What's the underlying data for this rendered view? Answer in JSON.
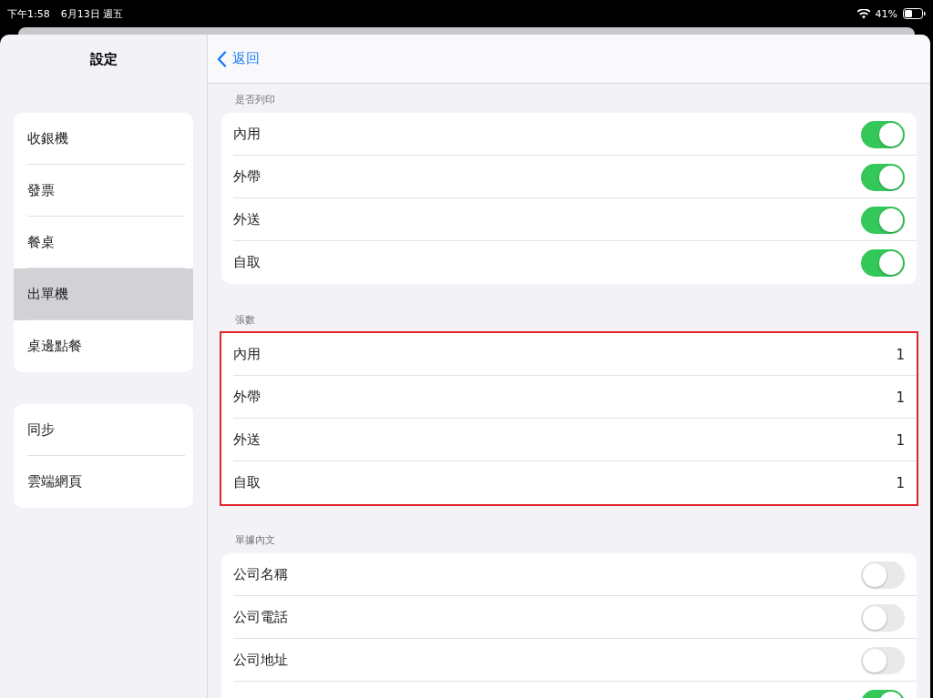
{
  "status_bar": {
    "time": "下午1:58",
    "date": "6月13日 週五",
    "battery": "41%"
  },
  "sidebar": {
    "title": "設定",
    "groups": [
      {
        "items": [
          {
            "label": "收銀機",
            "selected": false
          },
          {
            "label": "發票",
            "selected": false
          },
          {
            "label": "餐桌",
            "selected": false
          },
          {
            "label": "出單機",
            "selected": true
          },
          {
            "label": "桌邊點餐",
            "selected": false
          }
        ]
      },
      {
        "items": [
          {
            "label": "同步",
            "selected": false
          },
          {
            "label": "雲端網頁",
            "selected": false
          }
        ]
      }
    ]
  },
  "nav": {
    "back": "返回"
  },
  "sections": [
    {
      "header": "是否列印",
      "highlighted": false,
      "rows": [
        {
          "kind": "toggle",
          "label": "內用",
          "on": true
        },
        {
          "kind": "toggle",
          "label": "外帶",
          "on": true
        },
        {
          "kind": "toggle",
          "label": "外送",
          "on": true
        },
        {
          "kind": "toggle",
          "label": "自取",
          "on": true
        }
      ]
    },
    {
      "header": "張數",
      "highlighted": true,
      "rows": [
        {
          "kind": "value",
          "label": "內用",
          "value": "1"
        },
        {
          "kind": "value",
          "label": "外帶",
          "value": "1"
        },
        {
          "kind": "value",
          "label": "外送",
          "value": "1"
        },
        {
          "kind": "value",
          "label": "自取",
          "value": "1"
        }
      ]
    },
    {
      "header": "單據內文",
      "highlighted": false,
      "rows": [
        {
          "kind": "toggle",
          "label": "公司名稱",
          "on": false
        },
        {
          "kind": "toggle",
          "label": "公司電話",
          "on": false
        },
        {
          "kind": "toggle",
          "label": "公司地址",
          "on": false
        },
        {
          "kind": "toggle",
          "on": true
        }
      ]
    }
  ]
}
